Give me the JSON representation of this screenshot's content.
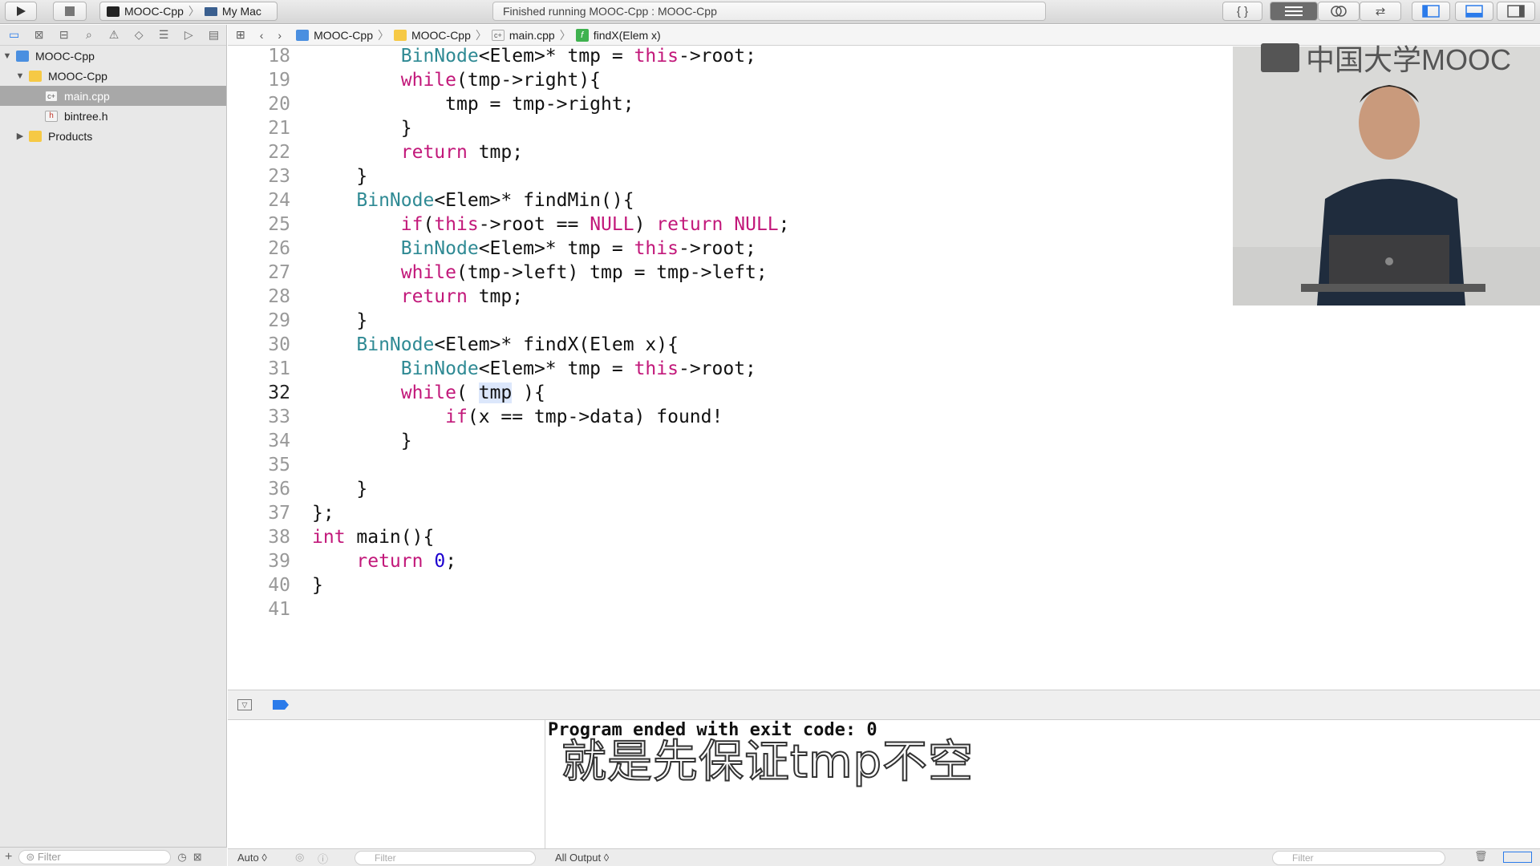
{
  "toolbar": {
    "scheme_target": "MOOC-Cpp",
    "scheme_device": "My Mac",
    "status": "Finished running MOOC-Cpp : MOOC-Cpp",
    "icons": [
      "run-icon",
      "stop-icon",
      "braces-icon",
      "standard-editor-icon",
      "assistant-editor-icon",
      "version-editor-icon",
      "left-panel-icon",
      "bottom-panel-icon",
      "right-panel-icon"
    ]
  },
  "sidebar": {
    "nav_icons": [
      "folder-icon",
      "source-control-icon",
      "hierarchy-icon",
      "search-icon",
      "warning-icon",
      "test-icon",
      "debug-icon",
      "breakpoint-icon",
      "report-icon"
    ],
    "tree": [
      {
        "label": "MOOC-Cpp",
        "kind": "project",
        "level": 0,
        "expanded": true
      },
      {
        "label": "MOOC-Cpp",
        "kind": "folder",
        "level": 1,
        "expanded": true
      },
      {
        "label": "main.cpp",
        "kind": "cpp",
        "level": 2,
        "selected": true
      },
      {
        "label": "bintree.h",
        "kind": "h",
        "level": 2
      },
      {
        "label": "Products",
        "kind": "folder",
        "level": 1,
        "expanded": false
      }
    ],
    "filter_placeholder": "Filter"
  },
  "jumpbar": {
    "crumbs": [
      "MOOC-Cpp",
      "MOOC-Cpp",
      "main.cpp",
      "findX(Elem x)"
    ]
  },
  "editor": {
    "current_line": 32,
    "lines": [
      {
        "n": 18,
        "indent": 8,
        "tokens": [
          [
            "t",
            "BinNode"
          ],
          [
            "",
            "<Elem>* tmp = "
          ],
          [
            "k",
            "this"
          ],
          [
            "",
            "->root;"
          ]
        ]
      },
      {
        "n": 19,
        "indent": 8,
        "tokens": [
          [
            "k",
            "while"
          ],
          [
            "",
            "(tmp->right){"
          ]
        ]
      },
      {
        "n": 20,
        "indent": 12,
        "tokens": [
          [
            "",
            "tmp = tmp->right;"
          ]
        ]
      },
      {
        "n": 21,
        "indent": 8,
        "tokens": [
          [
            "",
            "}"
          ]
        ]
      },
      {
        "n": 22,
        "indent": 8,
        "tokens": [
          [
            "k",
            "return"
          ],
          [
            "",
            " tmp;"
          ]
        ]
      },
      {
        "n": 23,
        "indent": 4,
        "tokens": [
          [
            "",
            "}"
          ]
        ]
      },
      {
        "n": 24,
        "indent": 4,
        "tokens": [
          [
            "t",
            "BinNode"
          ],
          [
            "",
            "<Elem>* findMin(){"
          ]
        ]
      },
      {
        "n": 25,
        "indent": 8,
        "tokens": [
          [
            "k",
            "if"
          ],
          [
            "",
            "("
          ],
          [
            "k",
            "this"
          ],
          [
            "",
            "->root == "
          ],
          [
            "k",
            "NULL"
          ],
          [
            "",
            ") "
          ],
          [
            "k",
            "return"
          ],
          [
            "",
            " "
          ],
          [
            "k",
            "NULL"
          ],
          [
            "",
            ";"
          ]
        ]
      },
      {
        "n": 26,
        "indent": 8,
        "tokens": [
          [
            "t",
            "BinNode"
          ],
          [
            "",
            "<Elem>* tmp = "
          ],
          [
            "k",
            "this"
          ],
          [
            "",
            "->root;"
          ]
        ]
      },
      {
        "n": 27,
        "indent": 8,
        "tokens": [
          [
            "k",
            "while"
          ],
          [
            "",
            "(tmp->left) tmp = tmp->left;"
          ]
        ]
      },
      {
        "n": 28,
        "indent": 8,
        "tokens": [
          [
            "k",
            "return"
          ],
          [
            "",
            " tmp;"
          ]
        ]
      },
      {
        "n": 29,
        "indent": 4,
        "tokens": [
          [
            "",
            "}"
          ]
        ]
      },
      {
        "n": 30,
        "indent": 4,
        "tokens": [
          [
            "t",
            "BinNode"
          ],
          [
            "",
            "<Elem>* findX(Elem x){"
          ]
        ]
      },
      {
        "n": 31,
        "indent": 8,
        "tokens": [
          [
            "t",
            "BinNode"
          ],
          [
            "",
            "<Elem>* tmp = "
          ],
          [
            "k",
            "this"
          ],
          [
            "",
            "->root;"
          ]
        ]
      },
      {
        "n": 32,
        "indent": 8,
        "tokens": [
          [
            "k",
            "while"
          ],
          [
            "",
            "( "
          ],
          [
            "hl",
            "tmp"
          ],
          [
            "",
            " ){"
          ]
        ]
      },
      {
        "n": 33,
        "indent": 12,
        "tokens": [
          [
            "k",
            "if"
          ],
          [
            "",
            "(x == tmp->data) found!"
          ]
        ]
      },
      {
        "n": 34,
        "indent": 8,
        "tokens": [
          [
            "",
            "}"
          ]
        ]
      },
      {
        "n": 35,
        "indent": 0,
        "tokens": []
      },
      {
        "n": 36,
        "indent": 4,
        "tokens": [
          [
            "",
            "}"
          ]
        ]
      },
      {
        "n": 37,
        "indent": 0,
        "tokens": [
          [
            "",
            "};"
          ]
        ]
      },
      {
        "n": 38,
        "indent": 0,
        "tokens": [
          [
            "k",
            "int"
          ],
          [
            "",
            " main(){"
          ]
        ]
      },
      {
        "n": 39,
        "indent": 4,
        "tokens": [
          [
            "k",
            "return"
          ],
          [
            "",
            " "
          ],
          [
            "n",
            "0"
          ],
          [
            "",
            ";"
          ]
        ]
      },
      {
        "n": 40,
        "indent": 0,
        "tokens": [
          [
            "",
            "}"
          ]
        ]
      },
      {
        "n": 41,
        "indent": 0,
        "tokens": []
      }
    ]
  },
  "overlay": {
    "watermark": "中国大学MOOC",
    "subtitle": "就是先保证tmp不空"
  },
  "console": {
    "output": "Program ended with exit code: 0"
  },
  "bottombar": {
    "auto_label": "Auto ◊",
    "left_filter": "Filter",
    "output_label": "All Output ◊",
    "right_filter": "Filter"
  }
}
